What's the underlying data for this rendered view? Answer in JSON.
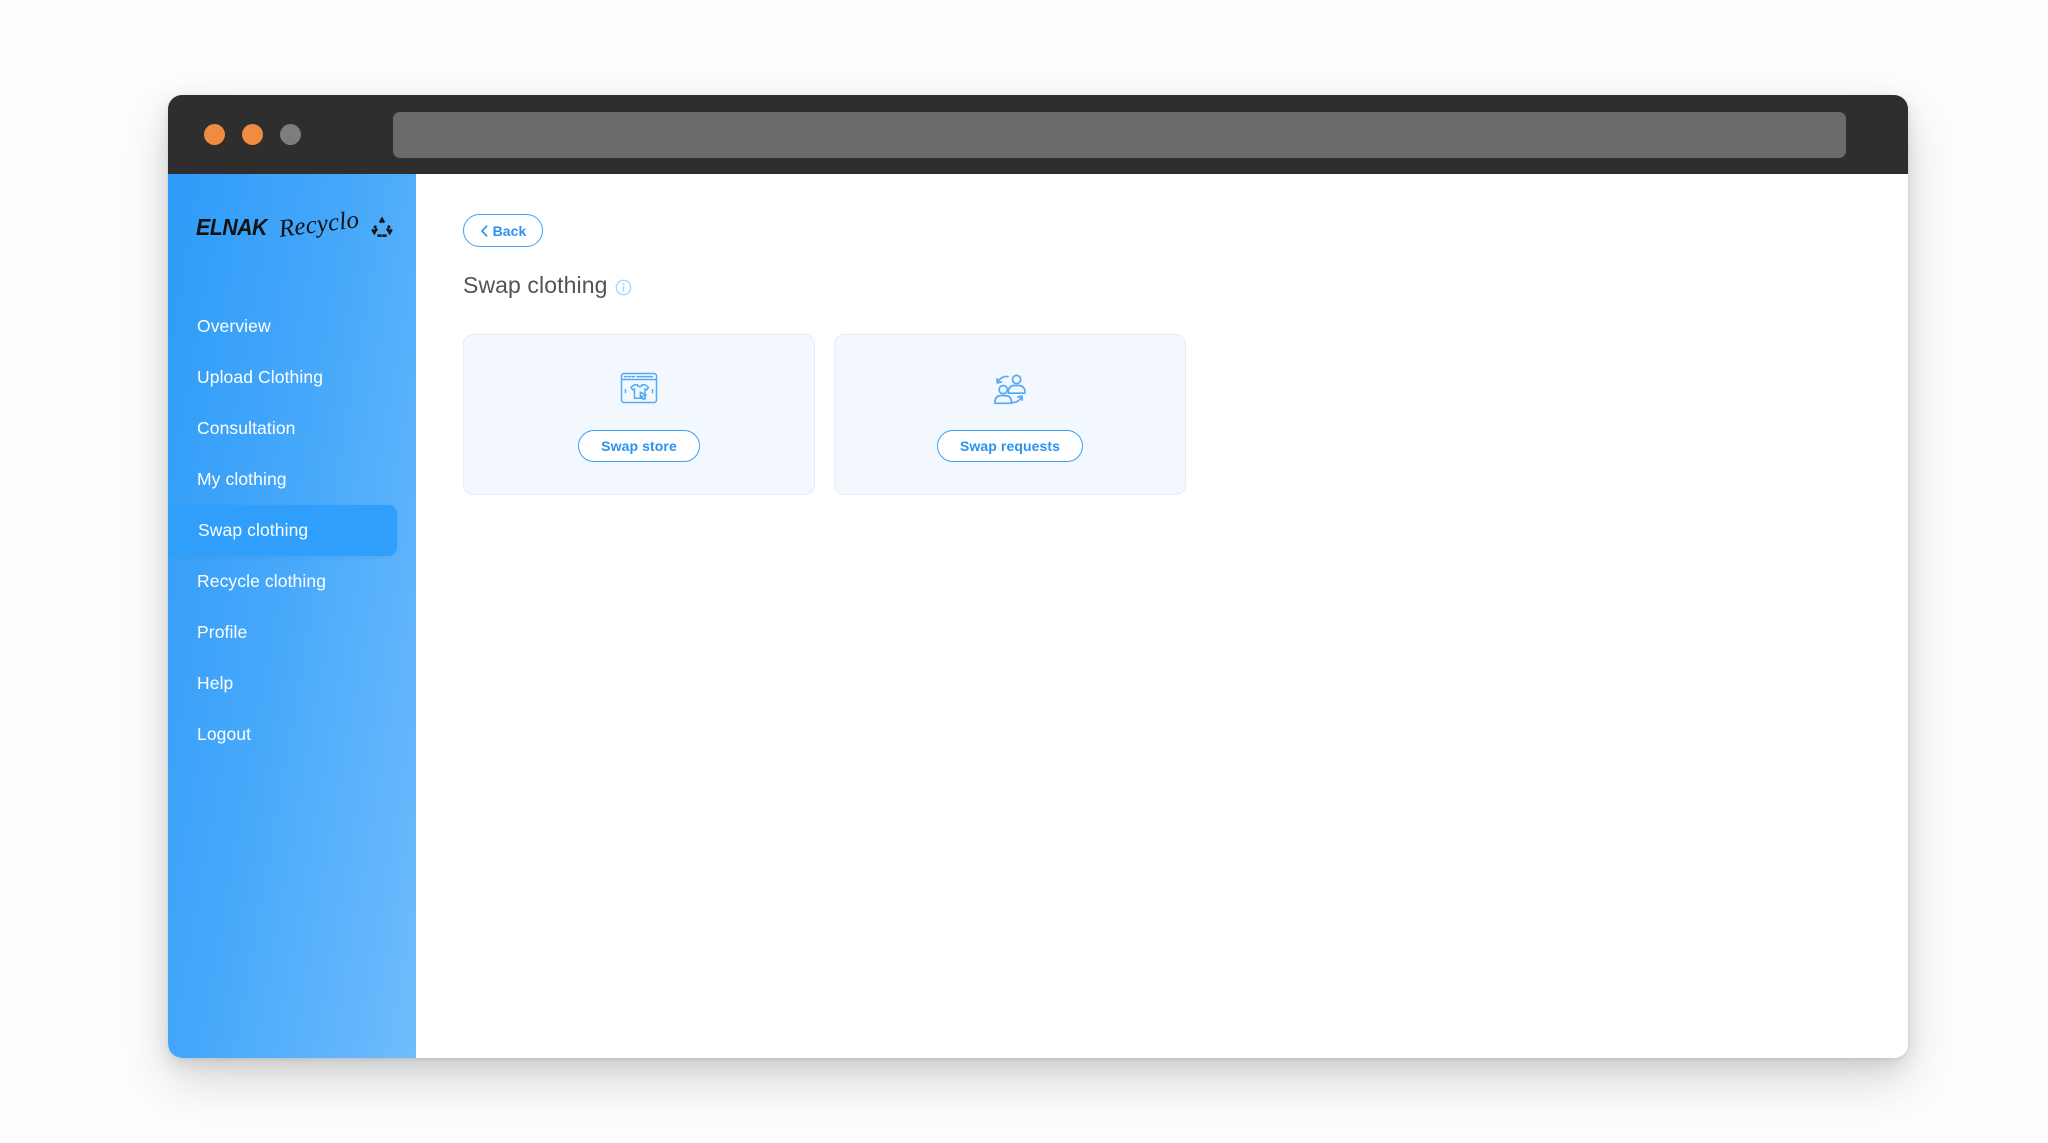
{
  "window": {
    "traffic_lights": [
      {
        "name": "close",
        "color": "#ef8c3f"
      },
      {
        "name": "minimize",
        "color": "#ef8c3f"
      },
      {
        "name": "zoom",
        "color": "#7d7d7d"
      }
    ],
    "address_bar": {
      "value": "",
      "placeholder": ""
    }
  },
  "sidebar": {
    "brand": {
      "name_primary": "ELNAK",
      "name_script": "Recyclo",
      "icon": "recycle-icon"
    },
    "accent_color": "#2f9ffb",
    "items": [
      {
        "label": "Overview",
        "active": false
      },
      {
        "label": "Upload Clothing",
        "active": false
      },
      {
        "label": "Consultation",
        "active": false
      },
      {
        "label": "My clothing",
        "active": false
      },
      {
        "label": "Swap clothing",
        "active": true
      },
      {
        "label": "Recycle clothing",
        "active": false
      },
      {
        "label": "Profile",
        "active": false
      },
      {
        "label": "Help",
        "active": false
      },
      {
        "label": "Logout",
        "active": false
      }
    ]
  },
  "main": {
    "back_button": {
      "label": "Back",
      "icon": "chevron-left-icon"
    },
    "page_title": "Swap clothing",
    "title_info_icon": "info-circle-icon",
    "cards": [
      {
        "icon": "storefront-tshirt-click-icon",
        "button_label": "Swap store"
      },
      {
        "icon": "people-swap-icon",
        "button_label": "Swap requests"
      }
    ]
  },
  "colors": {
    "brand_blue": "#2b92f0",
    "sidebar_gradient_start": "#2d9bf8",
    "sidebar_gradient_end": "#6fbcfc",
    "card_background": "#f2f8fe",
    "title_bar": "#2e2e2e",
    "page_title_text": "#515356"
  }
}
